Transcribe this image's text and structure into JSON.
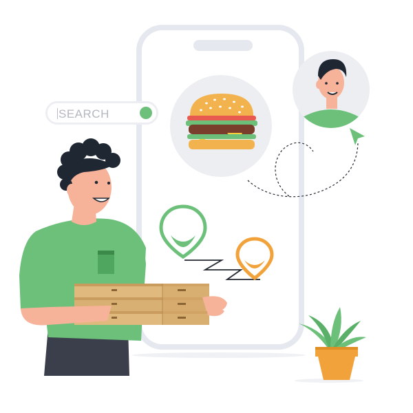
{
  "search": {
    "text": "SEARCH",
    "button_color": "#6cc07a"
  },
  "colors": {
    "accent_green": "#6cc07a",
    "accent_orange": "#f2a23a",
    "phone_border": "#e6e8ef",
    "box_tan": "#e0b97e",
    "skin": "#f7b39a",
    "hair": "#1f2733"
  },
  "icons": {
    "food": "burger-icon",
    "pickup_location": "location-pin-green-icon",
    "dropoff_location": "location-pin-orange-icon",
    "pointer": "cursor-arrow-icon"
  }
}
